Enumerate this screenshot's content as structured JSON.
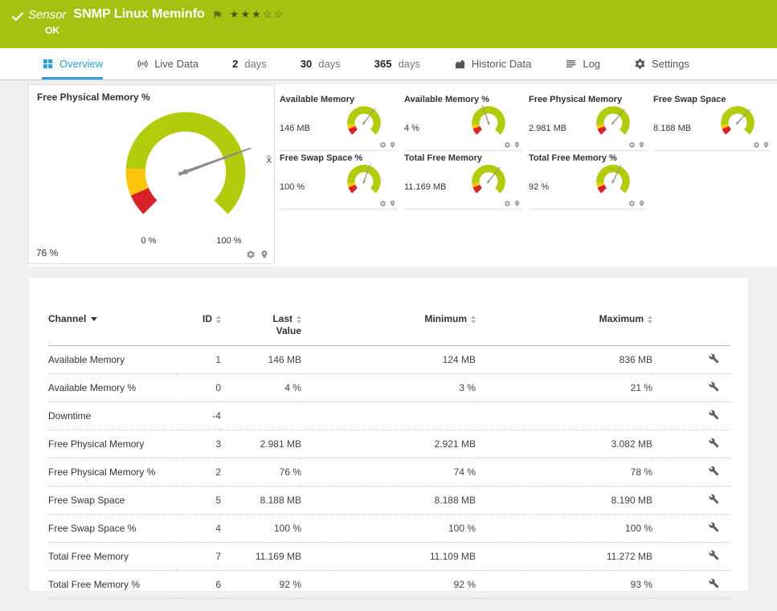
{
  "header": {
    "kind": "Sensor",
    "title": "SNMP Linux Meminfo",
    "status": "OK",
    "stars": "★★★☆☆",
    "rating_filled": 3,
    "rating_total": 5
  },
  "tabs": {
    "overview": "Overview",
    "live_data": "Live Data",
    "d2_num": "2",
    "d30_num": "30",
    "d365_num": "365",
    "days_label": "days",
    "historic": "Historic Data",
    "log": "Log",
    "settings": "Settings"
  },
  "main_gauge": {
    "title": "Free Physical Memory %",
    "value": "76 %",
    "scale_min": "0 %",
    "scale_max": "100 %",
    "needle_deg": 70,
    "avg_symbol": "x̄"
  },
  "mini_gauges": [
    {
      "title": "Available Memory",
      "value": "146 MB",
      "needle_deg": 38
    },
    {
      "title": "Available Memory %",
      "value": "4 %",
      "needle_deg": -20
    },
    {
      "title": "Free Physical Memory",
      "value": "2.981 MB",
      "needle_deg": 40
    },
    {
      "title": "Free Swap Space",
      "value": "8.188 MB",
      "needle_deg": 42
    },
    {
      "title": "Free Swap Space %",
      "value": "100 %",
      "needle_deg": 20
    },
    {
      "title": "Total Free Memory",
      "value": "11.169 MB",
      "needle_deg": 38
    },
    {
      "title": "Total Free Memory %",
      "value": "92 %",
      "needle_deg": 26
    }
  ],
  "table": {
    "headers": {
      "channel": "Channel",
      "id": "ID",
      "last1": "Last",
      "last2": "Value",
      "minimum": "Minimum",
      "maximum": "Maximum"
    },
    "rows": [
      {
        "channel": "Available Memory",
        "id": "1",
        "last": "146 MB",
        "min": "124 MB",
        "max": "836 MB"
      },
      {
        "channel": "Available Memory %",
        "id": "0",
        "last": "4 %",
        "min": "3 %",
        "max": "21 %"
      },
      {
        "channel": "Downtime",
        "id": "-4",
        "last": "",
        "min": "",
        "max": ""
      },
      {
        "channel": "Free Physical Memory",
        "id": "3",
        "last": "2.981 MB",
        "min": "2.921 MB",
        "max": "3.082 MB"
      },
      {
        "channel": "Free Physical Memory %",
        "id": "2",
        "last": "76 %",
        "min": "74 %",
        "max": "78 %"
      },
      {
        "channel": "Free Swap Space",
        "id": "5",
        "last": "8.188 MB",
        "min": "8.188 MB",
        "max": "8.190 MB"
      },
      {
        "channel": "Free Swap Space %",
        "id": "4",
        "last": "100 %",
        "min": "100 %",
        "max": "100 %"
      },
      {
        "channel": "Total Free Memory",
        "id": "7",
        "last": "11.169 MB",
        "min": "11.109 MB",
        "max": "11.272 MB"
      },
      {
        "channel": "Total Free Memory %",
        "id": "6",
        "last": "92 %",
        "min": "92 %",
        "max": "93 %"
      }
    ]
  },
  "colors": {
    "header_green": "#a7c113",
    "active_tab_blue": "#2d9fd8",
    "gauge_green": "#b2cb0c",
    "gauge_yellow": "#fdc50b",
    "gauge_red": "#d8222a",
    "needle_gray": "#8c8c8c"
  }
}
